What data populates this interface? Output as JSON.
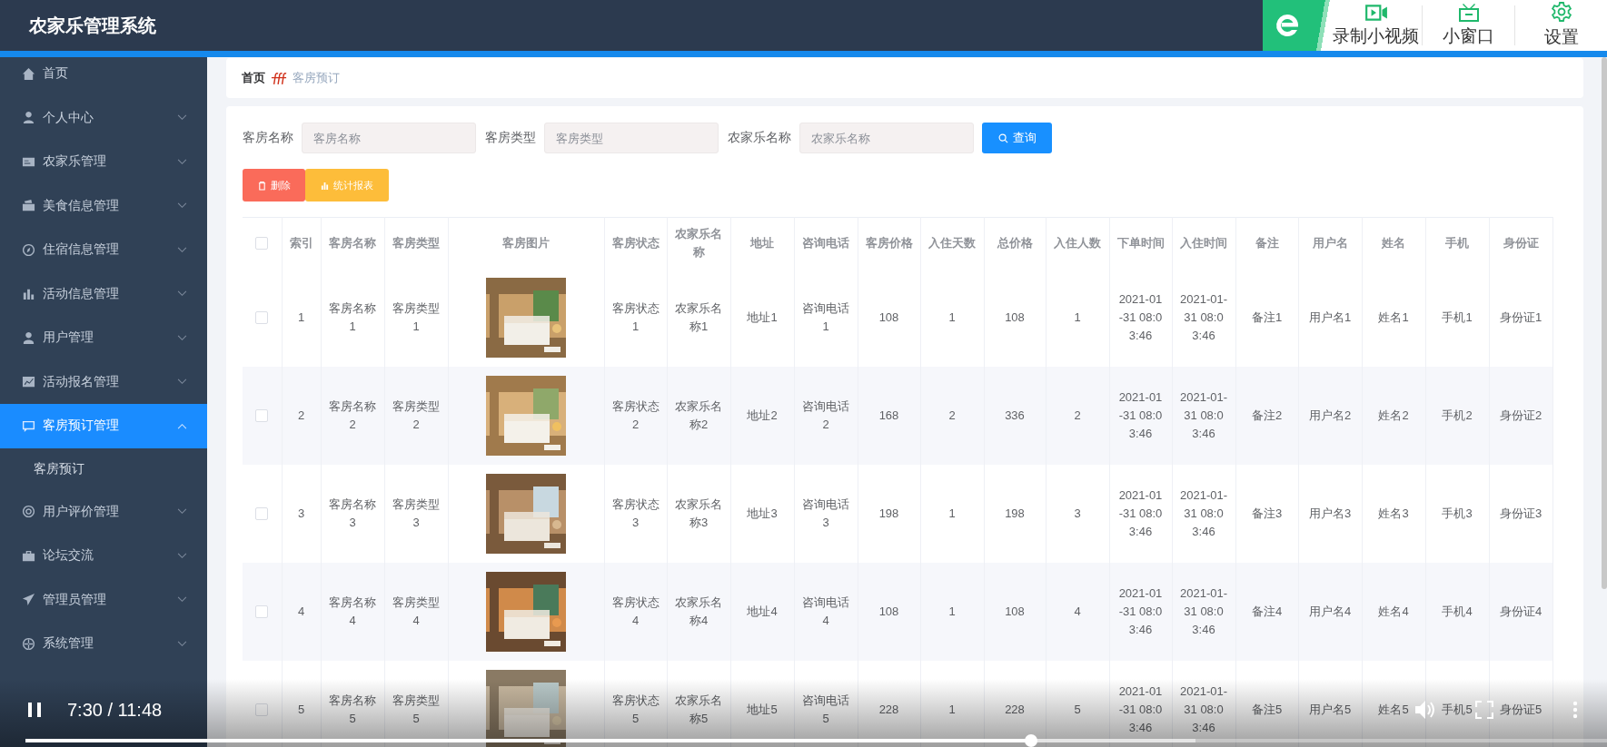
{
  "header": {
    "title": "农家乐管理系统"
  },
  "recorder_toolbar": {
    "items": [
      {
        "label": "录制小视频"
      },
      {
        "label": "小窗口"
      },
      {
        "label": "设置"
      }
    ]
  },
  "sidebar": {
    "items": [
      {
        "kind": "link",
        "label": "首页",
        "selected": false
      },
      {
        "kind": "submenu",
        "label": "个人中心",
        "selected": false,
        "expanded": false
      },
      {
        "kind": "submenu",
        "label": "农家乐管理",
        "selected": false,
        "expanded": false
      },
      {
        "kind": "submenu",
        "label": "美食信息管理",
        "selected": false,
        "expanded": false
      },
      {
        "kind": "submenu",
        "label": "住宿信息管理",
        "selected": false,
        "expanded": false
      },
      {
        "kind": "submenu",
        "label": "活动信息管理",
        "selected": false,
        "expanded": false
      },
      {
        "kind": "submenu",
        "label": "用户管理",
        "selected": false,
        "expanded": false
      },
      {
        "kind": "submenu",
        "label": "活动报名管理",
        "selected": false,
        "expanded": false
      },
      {
        "kind": "submenu",
        "label": "客房预订管理",
        "selected": true,
        "expanded": true,
        "children": [
          {
            "label": "客房预订",
            "selected": false
          }
        ]
      },
      {
        "kind": "submenu",
        "label": "用户评价管理",
        "selected": false,
        "expanded": false
      },
      {
        "kind": "submenu",
        "label": "论坛交流",
        "selected": false,
        "expanded": false
      },
      {
        "kind": "submenu",
        "label": "管理员管理",
        "selected": false,
        "expanded": false
      },
      {
        "kind": "submenu",
        "label": "系统管理",
        "selected": false,
        "expanded": false
      }
    ]
  },
  "breadcrumb": {
    "home": "首页",
    "current": "客房预订"
  },
  "search": {
    "fields": [
      {
        "label": "客房名称",
        "placeholder": "客房名称"
      },
      {
        "label": "客房类型",
        "placeholder": "客房类型"
      },
      {
        "label": "农家乐名称",
        "placeholder": "农家乐名称"
      }
    ],
    "button": "查询"
  },
  "actions": [
    {
      "kind": "delete",
      "label": "删除"
    },
    {
      "kind": "report",
      "label": "统计报表"
    }
  ],
  "table": {
    "header_checkbox": {
      "checked": false
    },
    "columns": [
      "索引",
      "客房名称",
      "客房类型",
      "客房图片",
      "客房状态",
      "农家乐名称",
      "地址",
      "咨询电话",
      "客房价格",
      "入住天数",
      "总价格",
      "入住人数",
      "下单时间",
      "入住时间",
      "备注",
      "用户名",
      "姓名",
      "手机",
      "身份证"
    ],
    "rows": [
      {
        "checked": false,
        "cells": [
          "1",
          "客房名称1",
          "客房类型1",
          {
            "kind": "picture"
          },
          "客房状态1",
          "农家乐名称1",
          "地址1",
          "咨询电话1",
          "108",
          "1",
          "108",
          "1",
          "2021-01-31 08:03:46",
          "2021-01-31 08:03:46",
          "备注1",
          "用户名1",
          "姓名1",
          "手机1",
          "身份证1"
        ]
      },
      {
        "checked": false,
        "cells": [
          "2",
          "客房名称2",
          "客房类型2",
          {
            "kind": "picture"
          },
          "客房状态2",
          "农家乐名称2",
          "地址2",
          "咨询电话2",
          "168",
          "2",
          "336",
          "2",
          "2021-01-31 08:03:46",
          "2021-01-31 08:03:46",
          "备注2",
          "用户名2",
          "姓名2",
          "手机2",
          "身份证2"
        ]
      },
      {
        "checked": false,
        "cells": [
          "3",
          "客房名称3",
          "客房类型3",
          {
            "kind": "picture"
          },
          "客房状态3",
          "农家乐名称3",
          "地址3",
          "咨询电话3",
          "198",
          "1",
          "198",
          "3",
          "2021-01-31 08:03:46",
          "2021-01-31 08:03:46",
          "备注3",
          "用户名3",
          "姓名3",
          "手机3",
          "身份证3"
        ]
      },
      {
        "checked": false,
        "cells": [
          "4",
          "客房名称4",
          "客房类型4",
          {
            "kind": "picture"
          },
          "客房状态4",
          "农家乐名称4",
          "地址4",
          "咨询电话4",
          "108",
          "1",
          "108",
          "4",
          "2021-01-31 08:03:46",
          "2021-01-31 08:03:46",
          "备注4",
          "用户名4",
          "姓名4",
          "手机4",
          "身份证4"
        ]
      },
      {
        "checked": false,
        "cells": [
          "5",
          "客房名称5",
          "客房类型5",
          {
            "kind": "picture"
          },
          "客房状态5",
          "农家乐名称5",
          "地址5",
          "咨询电话5",
          "228",
          "1",
          "228",
          "5",
          "2021-01-31 08:03:46",
          "2021-01-31 08:03:46",
          "备注5",
          "用户名5",
          "姓名5",
          "手机5",
          "身份证5"
        ]
      }
    ]
  },
  "player": {
    "playing": true,
    "time": "7:30 / 11:48",
    "progress": {
      "level": 0.636
    },
    "buffer": {
      "level": 0.74
    }
  }
}
